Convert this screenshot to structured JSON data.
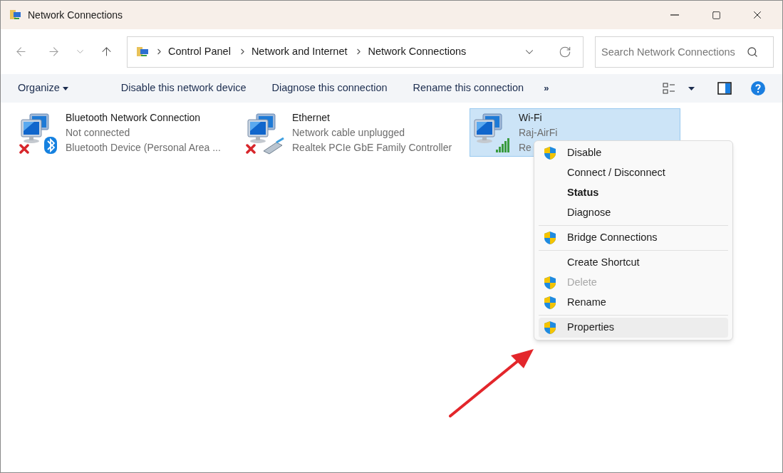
{
  "window": {
    "title": "Network Connections"
  },
  "address": {
    "crumbs": [
      "Control Panel",
      "Network and Internet",
      "Network Connections"
    ]
  },
  "search": {
    "placeholder": "Search Network Connections"
  },
  "commands": {
    "organize": "Organize",
    "actions": [
      "Disable this network device",
      "Diagnose this connection",
      "Rename this connection"
    ],
    "more": "»"
  },
  "connections": [
    {
      "kind": "bluetooth",
      "name": "Bluetooth Network Connection",
      "status": "Not connected",
      "device": "Bluetooth Device (Personal Area ...",
      "disconnected": true,
      "selected": false
    },
    {
      "kind": "ethernet",
      "name": "Ethernet",
      "status": "Network cable unplugged",
      "device": "Realtek PCIe GbE Family Controller",
      "disconnected": true,
      "selected": false
    },
    {
      "kind": "wifi",
      "name": "Wi-Fi",
      "status": "Raj-AirFi",
      "device": "Re",
      "disconnected": false,
      "selected": true
    }
  ],
  "context_menu": {
    "groups": [
      [
        {
          "label": "Disable",
          "shield": true,
          "default": false,
          "disabled": false,
          "selected": false
        },
        {
          "label": "Connect / Disconnect",
          "shield": false,
          "default": false,
          "disabled": false,
          "selected": false
        },
        {
          "label": "Status",
          "shield": false,
          "default": true,
          "disabled": false,
          "selected": false
        },
        {
          "label": "Diagnose",
          "shield": false,
          "default": false,
          "disabled": false,
          "selected": false
        }
      ],
      [
        {
          "label": "Bridge Connections",
          "shield": true,
          "default": false,
          "disabled": false,
          "selected": false
        }
      ],
      [
        {
          "label": "Create Shortcut",
          "shield": false,
          "default": false,
          "disabled": false,
          "selected": false
        },
        {
          "label": "Delete",
          "shield": true,
          "default": false,
          "disabled": true,
          "selected": false
        },
        {
          "label": "Rename",
          "shield": true,
          "default": false,
          "disabled": false,
          "selected": false
        }
      ],
      [
        {
          "label": "Properties",
          "shield": true,
          "default": false,
          "disabled": false,
          "selected": true
        }
      ]
    ]
  }
}
